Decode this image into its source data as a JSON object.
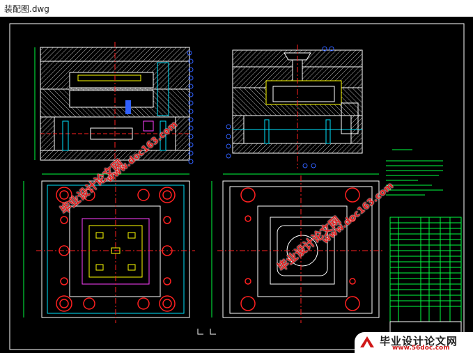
{
  "window": {
    "title": "装配图.dwg"
  },
  "watermarks": {
    "site_cn": "毕业设计论文网",
    "site_url": "www.56doc.com",
    "site_url_short": "www.doc163.com"
  },
  "colors": {
    "background": "#000000",
    "outline": "#ffffff",
    "red": "#ff2020",
    "cyan": "#00e5ff",
    "green": "#00ff40",
    "yellow": "#ffff00",
    "magenta": "#ff40ff",
    "blue": "#3060ff",
    "hatch": "#c8c8c8"
  },
  "logo": {
    "icon": "logo-mark-icon"
  }
}
